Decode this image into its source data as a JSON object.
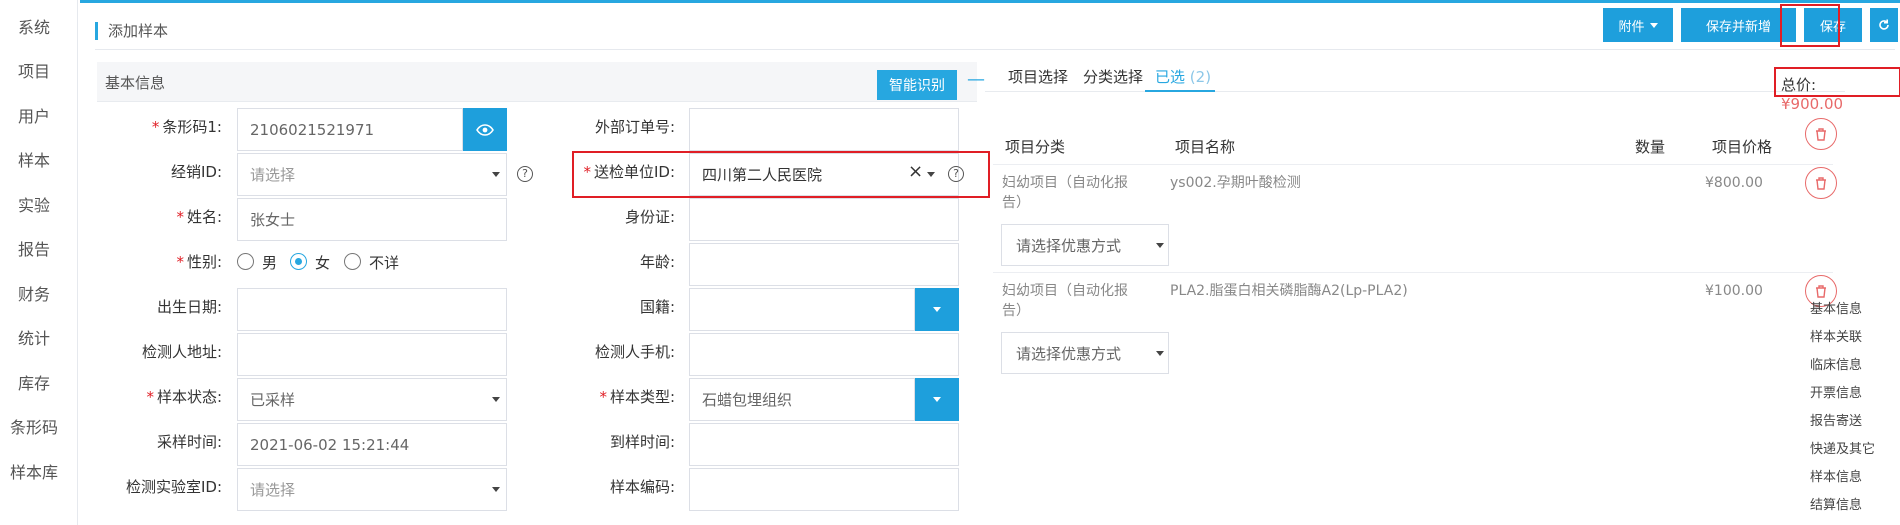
{
  "sidebar": {
    "items": [
      "系统",
      "项目",
      "用户",
      "样本",
      "实验",
      "报告",
      "财务",
      "统计",
      "库存",
      "条形码",
      "样本库"
    ]
  },
  "header": {
    "title": "添加样本",
    "attach_label": "附件",
    "save_new_label": "保存并新增",
    "save_label": "保存",
    "refresh_icon": "refresh-icon"
  },
  "basic": {
    "title": "基本信息",
    "ocr_label": "智能识别",
    "collapse_label": "—",
    "fields": {
      "barcode": {
        "label": "条形码1:",
        "value": "2106021521971"
      },
      "dealer": {
        "label": "经销ID:",
        "placeholder": "请选择"
      },
      "name": {
        "label": "姓名:",
        "value": "张女士"
      },
      "gender": {
        "label": "性别:",
        "options": [
          "男",
          "女",
          "不详"
        ],
        "selected": "女"
      },
      "birth": {
        "label": "出生日期:",
        "value": ""
      },
      "address": {
        "label": "检测人地址:",
        "value": ""
      },
      "sample_status": {
        "label": "样本状态:",
        "value": "已采样"
      },
      "sample_time": {
        "label": "采样时间:",
        "value": "2021-06-02 15:21:44"
      },
      "lab": {
        "label": "检测实验室ID:",
        "placeholder": "请选择"
      },
      "external_order": {
        "label": "外部订单号:",
        "value": ""
      },
      "sender_unit": {
        "label": "送检单位ID:",
        "value": "四川第二人民医院",
        "clear": "×"
      },
      "id_card": {
        "label": "身份证:",
        "value": ""
      },
      "age": {
        "label": "年龄:",
        "value": ""
      },
      "nationality": {
        "label": "国籍:",
        "value": ""
      },
      "phone": {
        "label": "检测人手机:",
        "value": ""
      },
      "sample_type": {
        "label": "样本类型:",
        "value": "石蜡包埋组织"
      },
      "arrival_time": {
        "label": "到样时间:",
        "value": ""
      },
      "sample_code": {
        "label": "样本编码:",
        "value": ""
      }
    }
  },
  "items": {
    "tabs": [
      "项目选择",
      "分类选择"
    ],
    "tab_selected": "已选",
    "tab_selected_count": "(2)",
    "total_label": "总价:",
    "total_value": "¥900.00",
    "collapse_label": "—",
    "columns": [
      "项目分类",
      "项目名称",
      "数量",
      "项目价格"
    ],
    "rows": [
      {
        "category_line1": "妇幼项目（自动化报",
        "category_line2": "告）",
        "name": "ys002.孕期叶酸检测",
        "price": "¥800.00",
        "discount_placeholder": "请选择优惠方式"
      },
      {
        "category_line1": "妇幼项目（自动化报",
        "category_line2": "告）",
        "name": "PLA2.脂蛋白相关磷脂酶A2(Lp-PLA2)",
        "price": "¥100.00",
        "discount_placeholder": "请选择优惠方式"
      }
    ]
  },
  "anchors": [
    "基本信息",
    "样本关联",
    "临床信息",
    "开票信息",
    "报告寄送",
    "快递及其它",
    "样本信息",
    "结算信息"
  ],
  "colors": {
    "accent": "#27a7e0",
    "highlight": "#e01e25",
    "danger": "#e86a6a"
  }
}
